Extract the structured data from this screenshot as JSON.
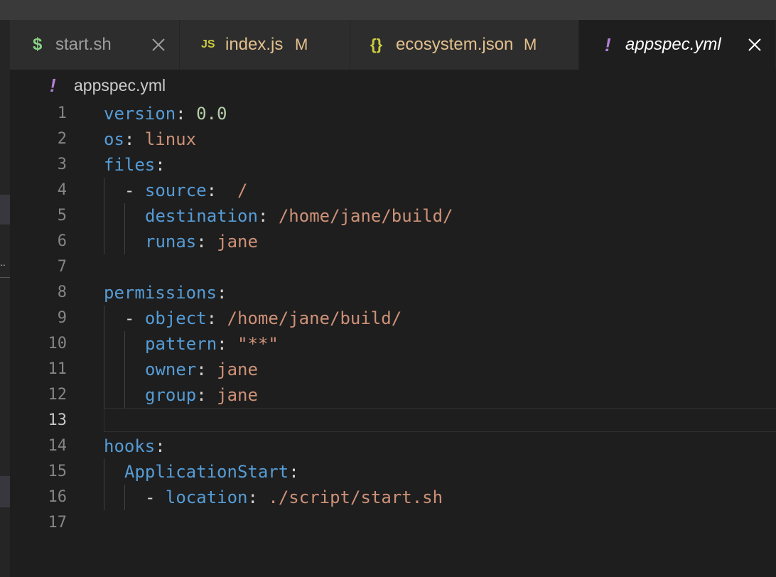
{
  "tabs": [
    {
      "icon": "$",
      "icon_name": "shell-script-icon",
      "icon_color": "#89d185",
      "label": "start.sh",
      "status": "",
      "active": false,
      "closable": true,
      "label_color": "#9d9d9d"
    },
    {
      "icon": "JS",
      "icon_name": "javascript-file-icon",
      "icon_color": "#cbcb41",
      "label": "index.js",
      "status": "M",
      "active": false,
      "closable": false,
      "label_color": "#e2c08d"
    },
    {
      "icon": "{}",
      "icon_name": "json-file-icon",
      "icon_color": "#cbcb41",
      "label": "ecosystem.json",
      "status": "M",
      "active": false,
      "closable": false,
      "label_color": "#e2c08d"
    },
    {
      "icon": "!",
      "icon_name": "yaml-file-icon",
      "icon_color": "#b180d7",
      "label": "appspec.yml",
      "status": "",
      "active": true,
      "closable": true,
      "label_color": "#ffffff"
    }
  ],
  "breadcrumb": {
    "icon": "!",
    "icon_name": "yaml-file-icon",
    "label": "appspec.yml"
  },
  "editor": {
    "current_line": 13,
    "lines": [
      {
        "n": "1",
        "indent": 0,
        "tokens": [
          [
            "k",
            "version"
          ],
          [
            "p",
            ": "
          ],
          [
            "n",
            "0.0"
          ]
        ]
      },
      {
        "n": "2",
        "indent": 0,
        "tokens": [
          [
            "k",
            "os"
          ],
          [
            "p",
            ": "
          ],
          [
            "s",
            "linux"
          ]
        ]
      },
      {
        "n": "3",
        "indent": 0,
        "tokens": [
          [
            "k",
            "files"
          ],
          [
            "p",
            ":"
          ]
        ]
      },
      {
        "n": "4",
        "indent": 1,
        "tokens": [
          [
            "p",
            "- "
          ],
          [
            "k",
            "source"
          ],
          [
            "p",
            ":  "
          ],
          [
            "s",
            "/"
          ]
        ]
      },
      {
        "n": "5",
        "indent": 2,
        "tokens": [
          [
            "k",
            "destination"
          ],
          [
            "p",
            ": "
          ],
          [
            "s",
            "/home/jane/build/"
          ]
        ]
      },
      {
        "n": "6",
        "indent": 2,
        "tokens": [
          [
            "k",
            "runas"
          ],
          [
            "p",
            ": "
          ],
          [
            "s",
            "jane"
          ]
        ]
      },
      {
        "n": "7",
        "indent": 0,
        "tokens": []
      },
      {
        "n": "8",
        "indent": 0,
        "tokens": [
          [
            "k",
            "permissions"
          ],
          [
            "p",
            ":"
          ]
        ]
      },
      {
        "n": "9",
        "indent": 1,
        "tokens": [
          [
            "p",
            "- "
          ],
          [
            "k",
            "object"
          ],
          [
            "p",
            ": "
          ],
          [
            "s",
            "/home/jane/build/"
          ]
        ]
      },
      {
        "n": "10",
        "indent": 2,
        "tokens": [
          [
            "k",
            "pattern"
          ],
          [
            "p",
            ": "
          ],
          [
            "s",
            "\"**\""
          ]
        ]
      },
      {
        "n": "11",
        "indent": 2,
        "tokens": [
          [
            "k",
            "owner"
          ],
          [
            "p",
            ": "
          ],
          [
            "s",
            "jane"
          ]
        ]
      },
      {
        "n": "12",
        "indent": 2,
        "tokens": [
          [
            "k",
            "group"
          ],
          [
            "p",
            ": "
          ],
          [
            "s",
            "jane"
          ]
        ]
      },
      {
        "n": "13",
        "indent": 0,
        "tokens": []
      },
      {
        "n": "14",
        "indent": 0,
        "tokens": [
          [
            "k",
            "hooks"
          ],
          [
            "p",
            ":"
          ]
        ]
      },
      {
        "n": "15",
        "indent": 1,
        "tokens": [
          [
            "k",
            "ApplicationStart"
          ],
          [
            "p",
            ":"
          ]
        ]
      },
      {
        "n": "16",
        "indent": 2,
        "tokens": [
          [
            "p",
            "- "
          ],
          [
            "k",
            "location"
          ],
          [
            "p",
            ": "
          ],
          [
            "s",
            "./script/start.sh"
          ]
        ]
      },
      {
        "n": "17",
        "indent": 0,
        "tokens": []
      }
    ]
  }
}
